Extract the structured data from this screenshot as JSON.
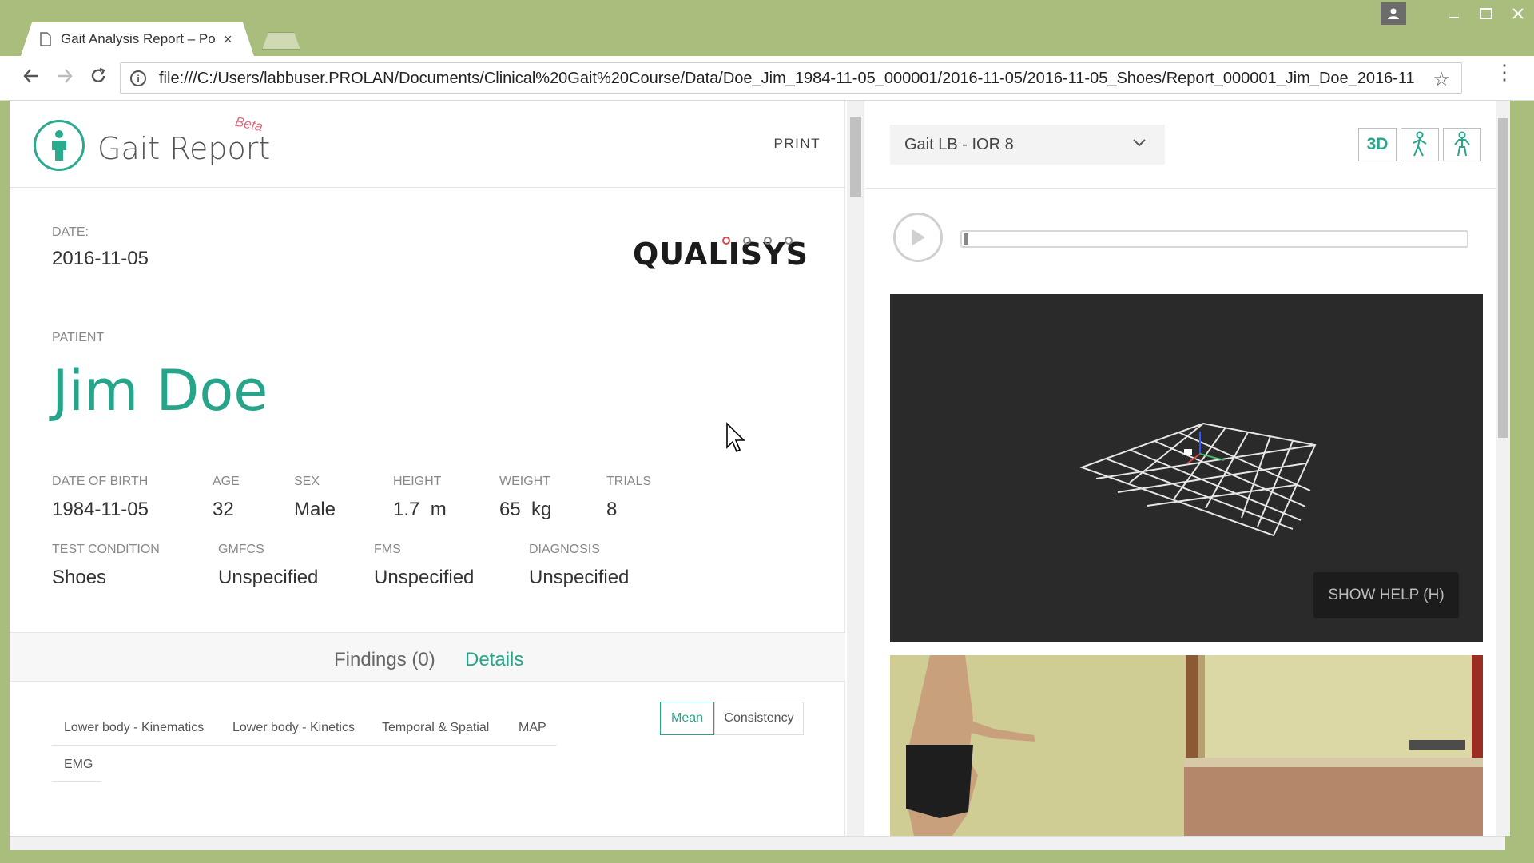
{
  "browser": {
    "tab_title": "Gait Analysis Report – Po",
    "tab_close": "×",
    "url": "file:///C:/Users/labbuser.PROLAN/Documents/Clinical%20Gait%20Course/Data/Doe_Jim_1984-11-05_000001/2016-11-05/2016-11-05_Shoes/Report_000001_Jim_Doe_2016-11"
  },
  "app": {
    "title": "Gait Report",
    "beta": "Beta",
    "print": "PRINT"
  },
  "report": {
    "date_label": "DATE:",
    "date": "2016-11-05",
    "brand": "QUALISYS",
    "patient_label": "PATIENT",
    "patient_name": "Jim Doe",
    "fields": {
      "dob": {
        "label": "DATE OF BIRTH",
        "value": "1984-11-05"
      },
      "age": {
        "label": "AGE",
        "value": "32"
      },
      "sex": {
        "label": "SEX",
        "value": "Male"
      },
      "height": {
        "label": "HEIGHT",
        "value": "1.7  m"
      },
      "weight": {
        "label": "WEIGHT",
        "value": "65  kg"
      },
      "trials": {
        "label": "TRIALS",
        "value": "8"
      },
      "condition": {
        "label": "TEST CONDITION",
        "value": "Shoes"
      },
      "gmfcs": {
        "label": "GMFCS",
        "value": "Unspecified"
      },
      "fms": {
        "label": "FMS",
        "value": "Unspecified"
      },
      "diagnosis": {
        "label": "DIAGNOSIS",
        "value": "Unspecified"
      }
    }
  },
  "tabs": {
    "findings": "Findings (0)",
    "details": "Details"
  },
  "sub_tabs": [
    "Lower body - Kinematics",
    "Lower body - Kinetics",
    "Temporal & Spatial",
    "MAP",
    "EMG"
  ],
  "toggle": {
    "mean": "Mean",
    "consistency": "Consistency"
  },
  "viewer": {
    "model_select": "Gait LB - IOR 8",
    "btn_3d": "3D",
    "help": "SHOW HELP (H)"
  },
  "colors": {
    "accent": "#27a58b",
    "window_frame": "#a9bd7c"
  }
}
